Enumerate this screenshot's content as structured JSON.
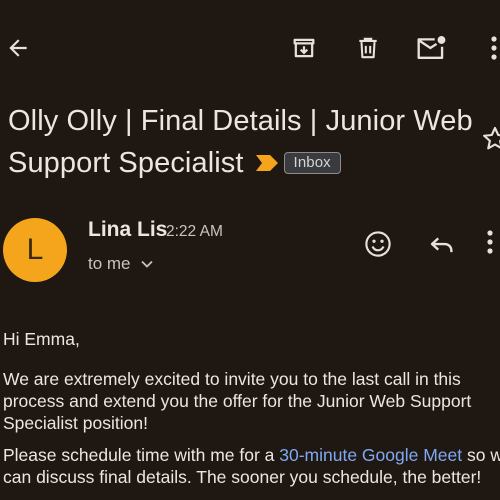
{
  "appbar": {
    "back": "back-arrow-icon",
    "archive": "archive-icon",
    "delete": "trash-icon",
    "mark_unread": "mark-unread-icon",
    "more": "more-vert-icon"
  },
  "subject": {
    "line1": "Olly Olly | Final Details | Junior Web",
    "line2": "Support Specialist",
    "label": "Inbox",
    "importance_color": "#f4a51b"
  },
  "sender": {
    "avatar_letter": "L",
    "avatar_color": "#f4a51b",
    "name": "Lina Lis",
    "time": "2:22 AM",
    "recipient": "to me"
  },
  "body": {
    "greeting": "Hi Emma,",
    "para1": "We are extremely excited to invite you to the last call in this process and extend you the offer for the Junior Web Support Specialist position!",
    "para2_before": "Please schedule time with me for a ",
    "para2_link": "30-minute Google Meet",
    "para2_after": " so we can discuss final details. The sooner you schedule, the better!",
    "link_color": "#7fa8f2"
  }
}
